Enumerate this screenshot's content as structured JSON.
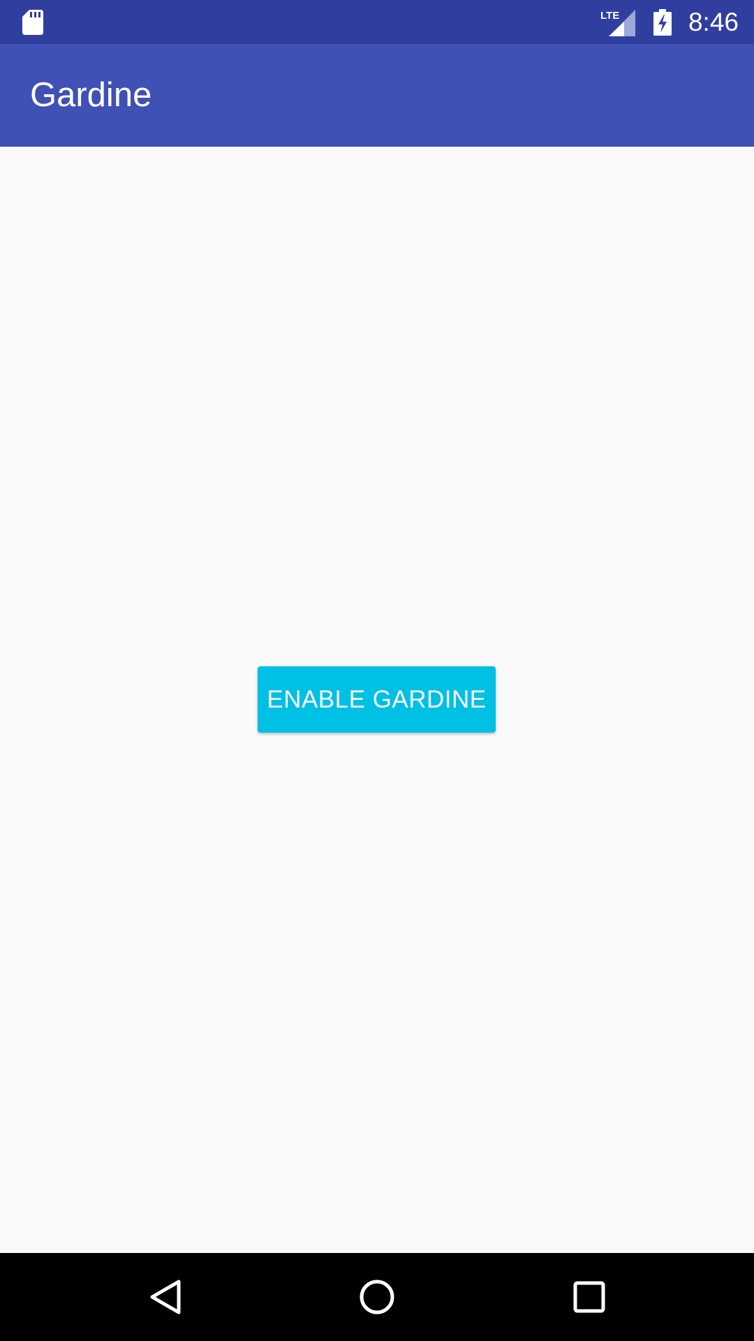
{
  "status_bar": {
    "time": "8:46",
    "network_label": "LTE",
    "icons": [
      "sd-card-icon",
      "lte-signal-icon",
      "battery-charging-icon"
    ]
  },
  "app_bar": {
    "title": "Gardine"
  },
  "main": {
    "enable_button_label": "ENABLE GARDINE"
  },
  "nav_bar": {
    "icons": [
      "back-icon",
      "home-icon",
      "recents-icon"
    ]
  },
  "colors": {
    "status_bar": "#303f9f",
    "app_bar": "#3f51b5",
    "background": "#fafafa",
    "button": "#00c0e4",
    "nav_bar": "#000000"
  }
}
